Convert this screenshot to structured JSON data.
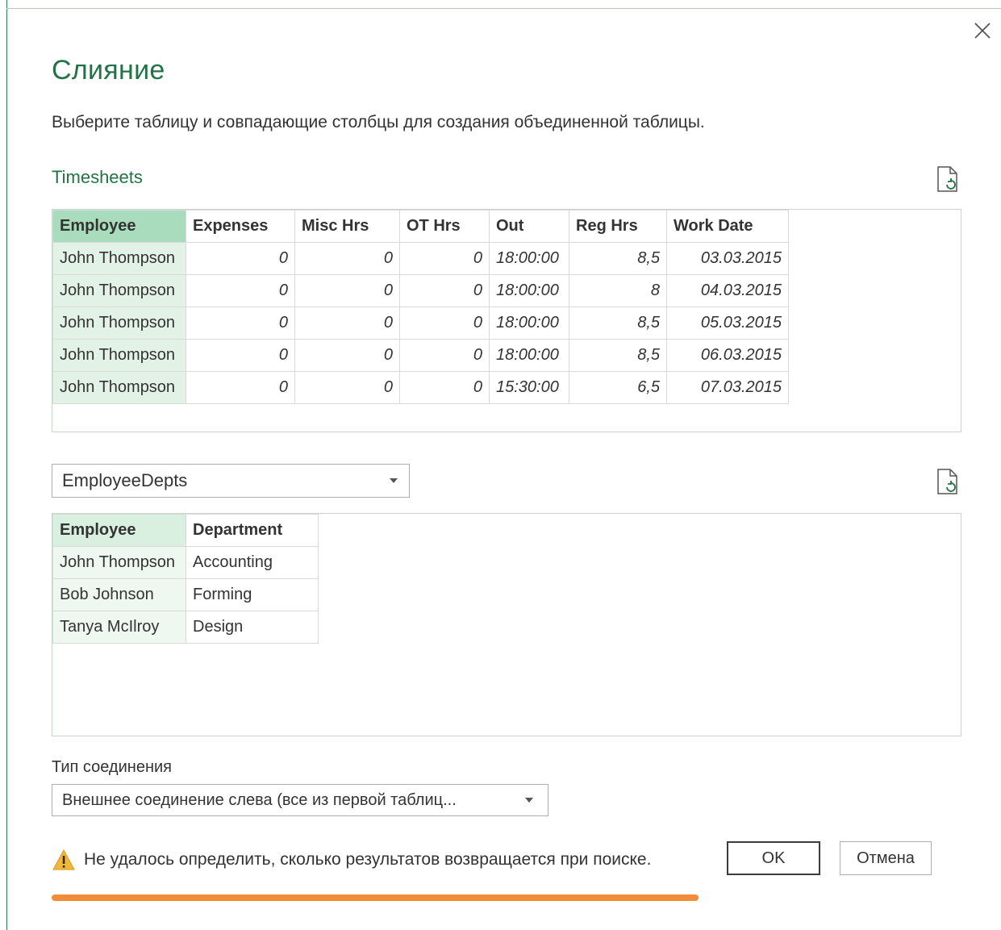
{
  "dialog": {
    "title": "Слияние",
    "subtitle": "Выберите таблицу и совпадающие столбцы для создания объединенной таблицы.",
    "close_icon": "close-icon"
  },
  "table1": {
    "label": "Timesheets",
    "refresh_icon": "refresh-file-icon",
    "headers": [
      "Employee",
      "Expenses",
      "Misc Hrs",
      "OT Hrs",
      "Out",
      "Reg Hrs",
      "Work Date"
    ],
    "rows": [
      [
        "John Thompson",
        "0",
        "0",
        "0",
        "18:00:00",
        "8,5",
        "03.03.2015"
      ],
      [
        "John Thompson",
        "0",
        "0",
        "0",
        "18:00:00",
        "8",
        "04.03.2015"
      ],
      [
        "John Thompson",
        "0",
        "0",
        "0",
        "18:00:00",
        "8,5",
        "05.03.2015"
      ],
      [
        "John Thompson",
        "0",
        "0",
        "0",
        "18:00:00",
        "8,5",
        "06.03.2015"
      ],
      [
        "John Thompson",
        "0",
        "0",
        "0",
        "15:30:00",
        "6,5",
        "07.03.2015"
      ]
    ]
  },
  "table2": {
    "select_value": "EmployeeDepts",
    "refresh_icon": "refresh-file-icon",
    "headers": [
      "Employee",
      "Department"
    ],
    "rows": [
      [
        "John Thompson",
        "Accounting"
      ],
      [
        "Bob Johnson",
        "Forming"
      ],
      [
        "Tanya McIlroy",
        "Design"
      ]
    ]
  },
  "join": {
    "label": "Тип соединения",
    "value": "Внешнее соединение слева (все из первой таблиц..."
  },
  "warning": {
    "icon": "warning-icon",
    "text": "Не удалось определить, сколько результатов возвращается при поиске."
  },
  "buttons": {
    "ok": "OK",
    "cancel": "Отмена"
  },
  "colors": {
    "accent": "#217346",
    "selected_column": "#a9dcbd",
    "progress": "#f28c38"
  },
  "progress": {
    "state": "indeterminate"
  }
}
